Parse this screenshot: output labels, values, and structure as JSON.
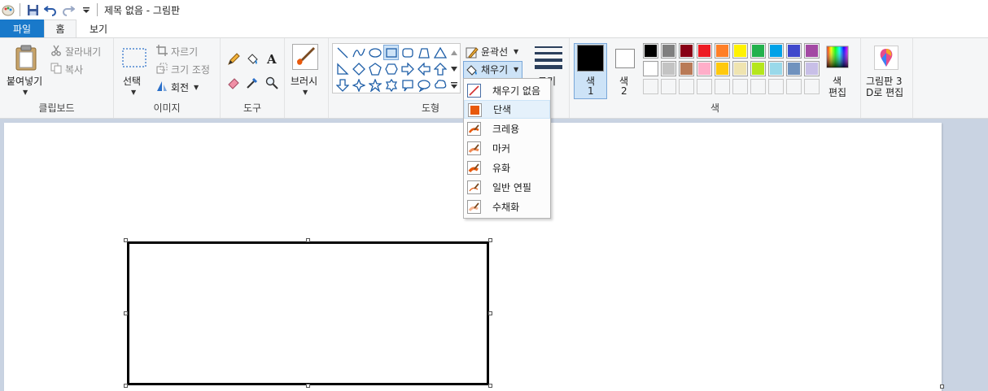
{
  "window": {
    "title": "제목 없음 - 그림판"
  },
  "tabs": [
    {
      "label": "파일"
    },
    {
      "label": "홈"
    },
    {
      "label": "보기"
    }
  ],
  "ribbon": {
    "clipboard": {
      "group_label": "클립보드",
      "paste": "붙여넣기",
      "cut": "잘라내기",
      "copy": "복사"
    },
    "image": {
      "group_label": "이미지",
      "select": "선택",
      "crop": "자르기",
      "resize": "크기 조정",
      "rotate": "회전"
    },
    "tools": {
      "group_label": "도구"
    },
    "brushes": {
      "label": "브러시"
    },
    "shapes": {
      "group_label": "도형",
      "outline": "윤곽선",
      "fill": "채우기"
    },
    "size": {
      "label": "크기"
    },
    "colors": {
      "group_label": "색",
      "color1_a": "색",
      "color1_b": "1",
      "color2_a": "색",
      "color2_b": "2",
      "edit_a": "색",
      "edit_b": "편집",
      "color1": "#000000",
      "color2": "#ffffff",
      "palette_row1": [
        "#000000",
        "#7f7f7f",
        "#880015",
        "#ed1c24",
        "#ff7f27",
        "#fff200",
        "#22b14c",
        "#00a2e8",
        "#3f48cc",
        "#a349a4"
      ],
      "palette_row2": [
        "#ffffff",
        "#c3c3c3",
        "#b97a57",
        "#ffaec9",
        "#ffc90e",
        "#efe4b0",
        "#b5e61d",
        "#99d9ea",
        "#7092be",
        "#c8bfe7"
      ]
    },
    "paint3d": {
      "label_a": "그림판 3",
      "label_b": "D로 편집"
    }
  },
  "fill_menu": {
    "items": [
      {
        "label": "채우기 없음"
      },
      {
        "label": "단색"
      },
      {
        "label": "크레용"
      },
      {
        "label": "마커"
      },
      {
        "label": "유화"
      },
      {
        "label": "일반 연필"
      },
      {
        "label": "수채화"
      }
    ],
    "accent": "#e8590c"
  }
}
